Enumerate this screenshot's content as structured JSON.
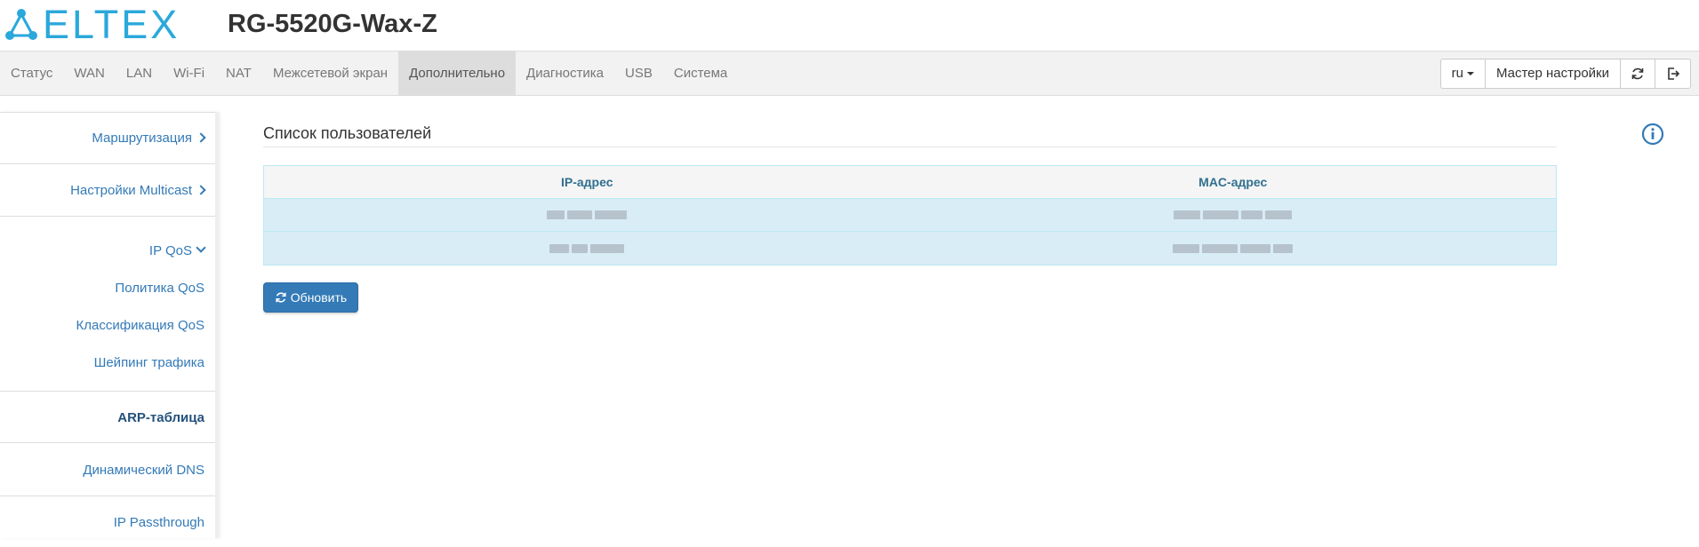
{
  "header": {
    "logo_text": "ELTEX",
    "model": "RG-5520G-Wax-Z"
  },
  "nav": {
    "items": [
      {
        "label": "Статус"
      },
      {
        "label": "WAN"
      },
      {
        "label": "LAN"
      },
      {
        "label": "Wi-Fi"
      },
      {
        "label": "NAT"
      },
      {
        "label": "Межсетевой экран"
      },
      {
        "label": "Дополнительно",
        "active": true
      },
      {
        "label": "Диагностика"
      },
      {
        "label": "USB"
      },
      {
        "label": "Система"
      }
    ],
    "lang": "ru",
    "wizard": "Мастер настройки",
    "refresh_icon": "refresh-icon",
    "logout_icon": "logout-icon"
  },
  "sidebar": {
    "items": [
      {
        "label": "Маршрутизация",
        "chevron": "right"
      },
      {
        "label": "Настройки Multicast",
        "chevron": "right"
      },
      {
        "label": "IP QoS",
        "chevron": "down"
      },
      {
        "label": "Политика QoS"
      },
      {
        "label": "Классификация QoS"
      },
      {
        "label": "Шейпинг трафика"
      },
      {
        "label": "ARP-таблица",
        "active": true
      },
      {
        "label": "Динамический DNS"
      },
      {
        "label": "IP Passthrough"
      }
    ]
  },
  "main": {
    "title": "Список пользователей",
    "info_icon": "info-icon",
    "table": {
      "columns": [
        "IP-адрес",
        "MAC-адрес"
      ],
      "rows": [
        {
          "ip": "",
          "mac": ""
        },
        {
          "ip": "",
          "mac": ""
        }
      ]
    },
    "refresh_label": "Обновить"
  },
  "colors": {
    "brand": "#2aa8dc",
    "link": "#337ab7",
    "primary_button": "#337ab7",
    "row_bg": "#d9edf7",
    "header_text": "#31708f"
  }
}
